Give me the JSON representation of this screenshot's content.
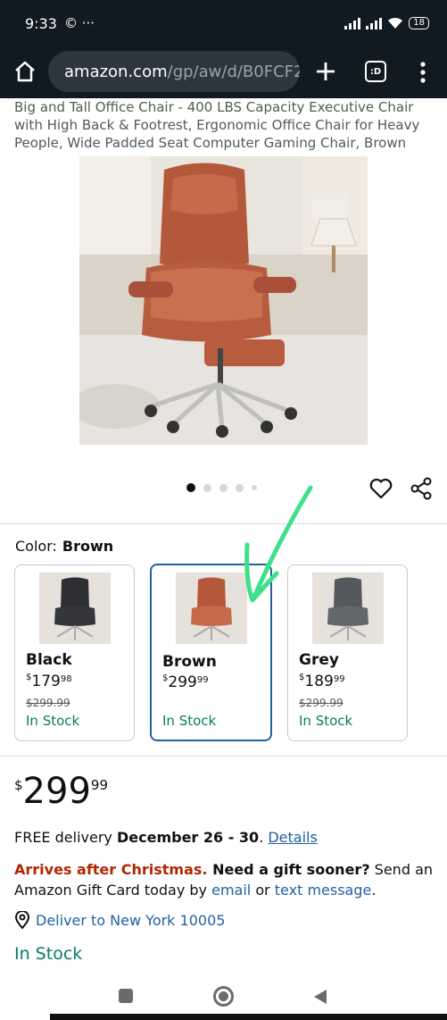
{
  "status_bar": {
    "time": "9:33",
    "left_icons": "© ···",
    "battery": "18"
  },
  "browser": {
    "url_domain": "amazon.com",
    "url_path": "/gp/aw/d/B0FCF2"
  },
  "product": {
    "title": "Big and Tall Office Chair - 400 LBS Capacity Executive Chair with High Back & Footrest, Ergonomic Office Chair for Heavy People, Wide Padded Seat Computer Gaming Chair, Brown"
  },
  "color": {
    "label": "Color:",
    "selected": "Brown",
    "options": [
      {
        "name": "Black",
        "currency": "$",
        "whole": "179",
        "fraction": "98",
        "list_price": "$299.99",
        "stock": "In Stock"
      },
      {
        "name": "Brown",
        "currency": "$",
        "whole": "299",
        "fraction": "99",
        "list_price": "",
        "stock": "In Stock"
      },
      {
        "name": "Grey",
        "currency": "$",
        "whole": "189",
        "fraction": "99",
        "list_price": "$299.99",
        "stock": "In Stock"
      }
    ]
  },
  "price": {
    "currency": "$",
    "whole": "299",
    "fraction": "99"
  },
  "delivery": {
    "prefix": "FREE delivery ",
    "dates": "December 26 - 30",
    "suffix": ". ",
    "details_link": "Details"
  },
  "gift": {
    "warning": "Arrives after Christmas.",
    "question": " Need a gift sooner?",
    "text1": " Send an Amazon Gift Card today by ",
    "email_link": "email",
    "or": " or ",
    "text_link": "text message",
    "end": "."
  },
  "deliver_to": "Deliver to New York 10005",
  "stock": "In Stock",
  "colors": {
    "accent_link": "#2162a1",
    "stock_green": "#067d62",
    "warning_red": "#b12704",
    "annotation": "#3ee08a"
  }
}
